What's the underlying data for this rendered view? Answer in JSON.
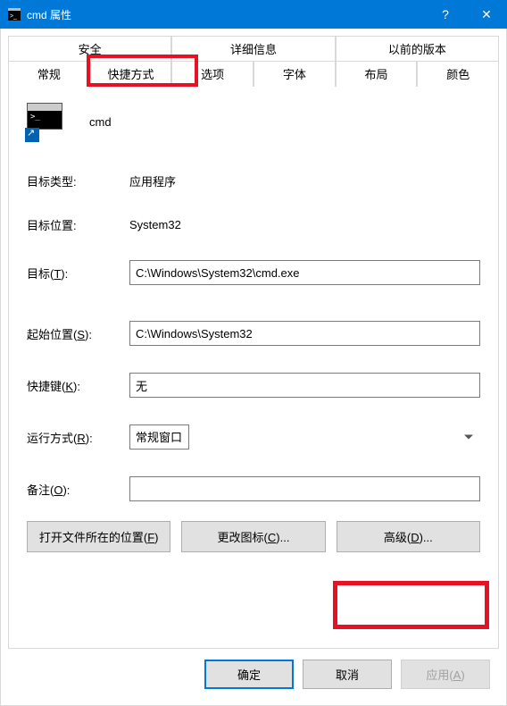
{
  "window": {
    "title": "cmd 属性"
  },
  "tabs": {
    "row1": [
      "安全",
      "详细信息",
      "以前的版本"
    ],
    "row2": [
      "常规",
      "快捷方式",
      "选项",
      "字体",
      "布局",
      "颜色"
    ],
    "active": "快捷方式"
  },
  "app": {
    "name": "cmd"
  },
  "fields": {
    "targetTypeLabel": "目标类型:",
    "targetTypeValue": "应用程序",
    "targetLocLabel": "目标位置:",
    "targetLocValue": "System32",
    "targetLabel": "目标(T):",
    "targetValue": "C:\\Windows\\System32\\cmd.exe",
    "startInLabel": "起始位置(S):",
    "startInValue": "C:\\Windows\\System32",
    "shortcutKeyLabel": "快捷键(K):",
    "shortcutKeyValue": "无",
    "runLabel": "运行方式(R):",
    "runValue": "常规窗口",
    "commentLabel": "备注(O):",
    "commentValue": ""
  },
  "buttons": {
    "openLocation": "打开文件所在的位置(F)",
    "changeIcon": "更改图标(C)...",
    "advanced": "高级(D)..."
  },
  "footer": {
    "ok": "确定",
    "cancel": "取消",
    "apply": "应用(A)"
  }
}
